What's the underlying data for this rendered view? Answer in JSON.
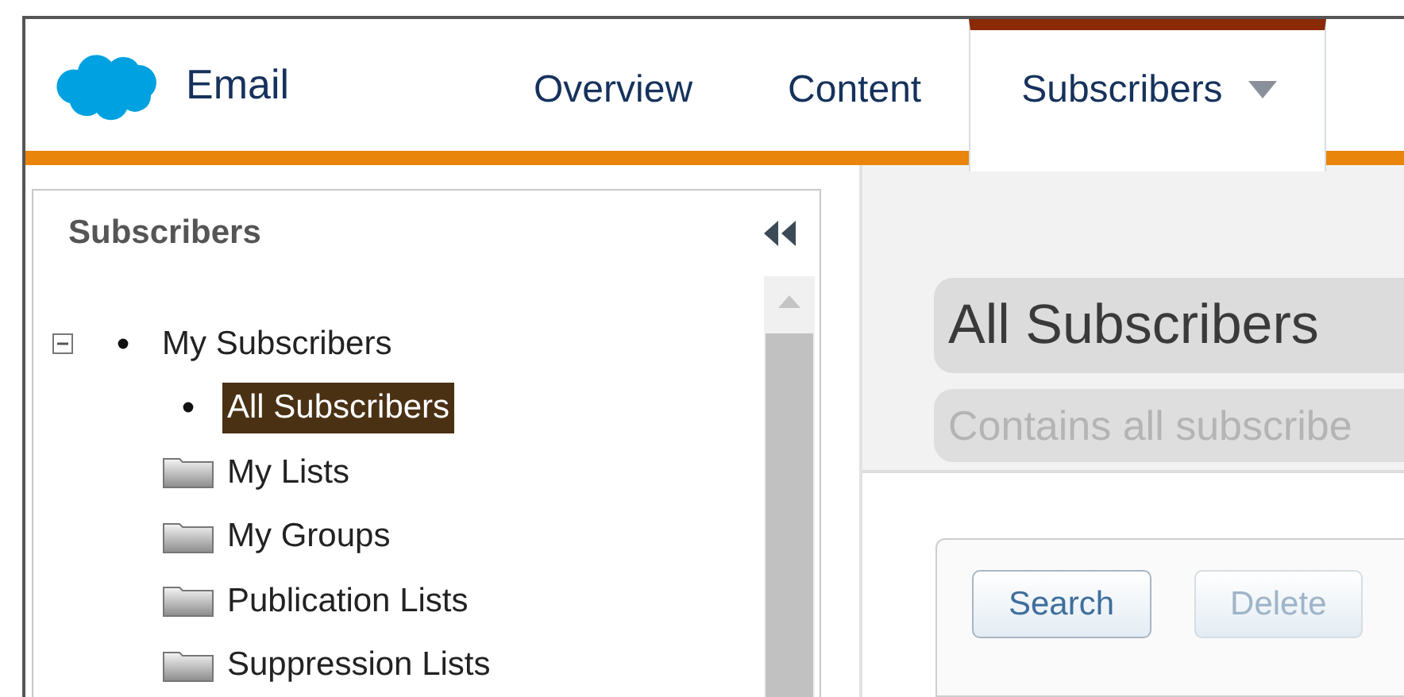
{
  "app": {
    "name": "Email"
  },
  "tabs": [
    {
      "label": "Overview",
      "selected": false,
      "dropdown": false
    },
    {
      "label": "Content",
      "selected": false,
      "dropdown": false
    },
    {
      "label": "Subscribers",
      "selected": true,
      "dropdown": true
    }
  ],
  "sidebar": {
    "title": "Subscribers",
    "tree": [
      {
        "label": "My Subscribers",
        "kind": "bullet",
        "selected": false,
        "expanded": true,
        "children": [
          {
            "label": "All Subscribers",
            "kind": "bullet",
            "selected": true
          },
          {
            "label": "My Lists",
            "kind": "folder",
            "selected": false
          },
          {
            "label": "My Groups",
            "kind": "folder",
            "selected": false
          },
          {
            "label": "Publication Lists",
            "kind": "folder",
            "selected": false
          },
          {
            "label": "Suppression Lists",
            "kind": "folder",
            "selected": false
          }
        ]
      }
    ]
  },
  "detail": {
    "title": "All Subscribers",
    "description": "Contains all subscribe"
  },
  "toolbar": {
    "buttons": [
      {
        "label": "Search",
        "disabled": false
      },
      {
        "label": "Delete",
        "disabled": true
      }
    ]
  }
}
